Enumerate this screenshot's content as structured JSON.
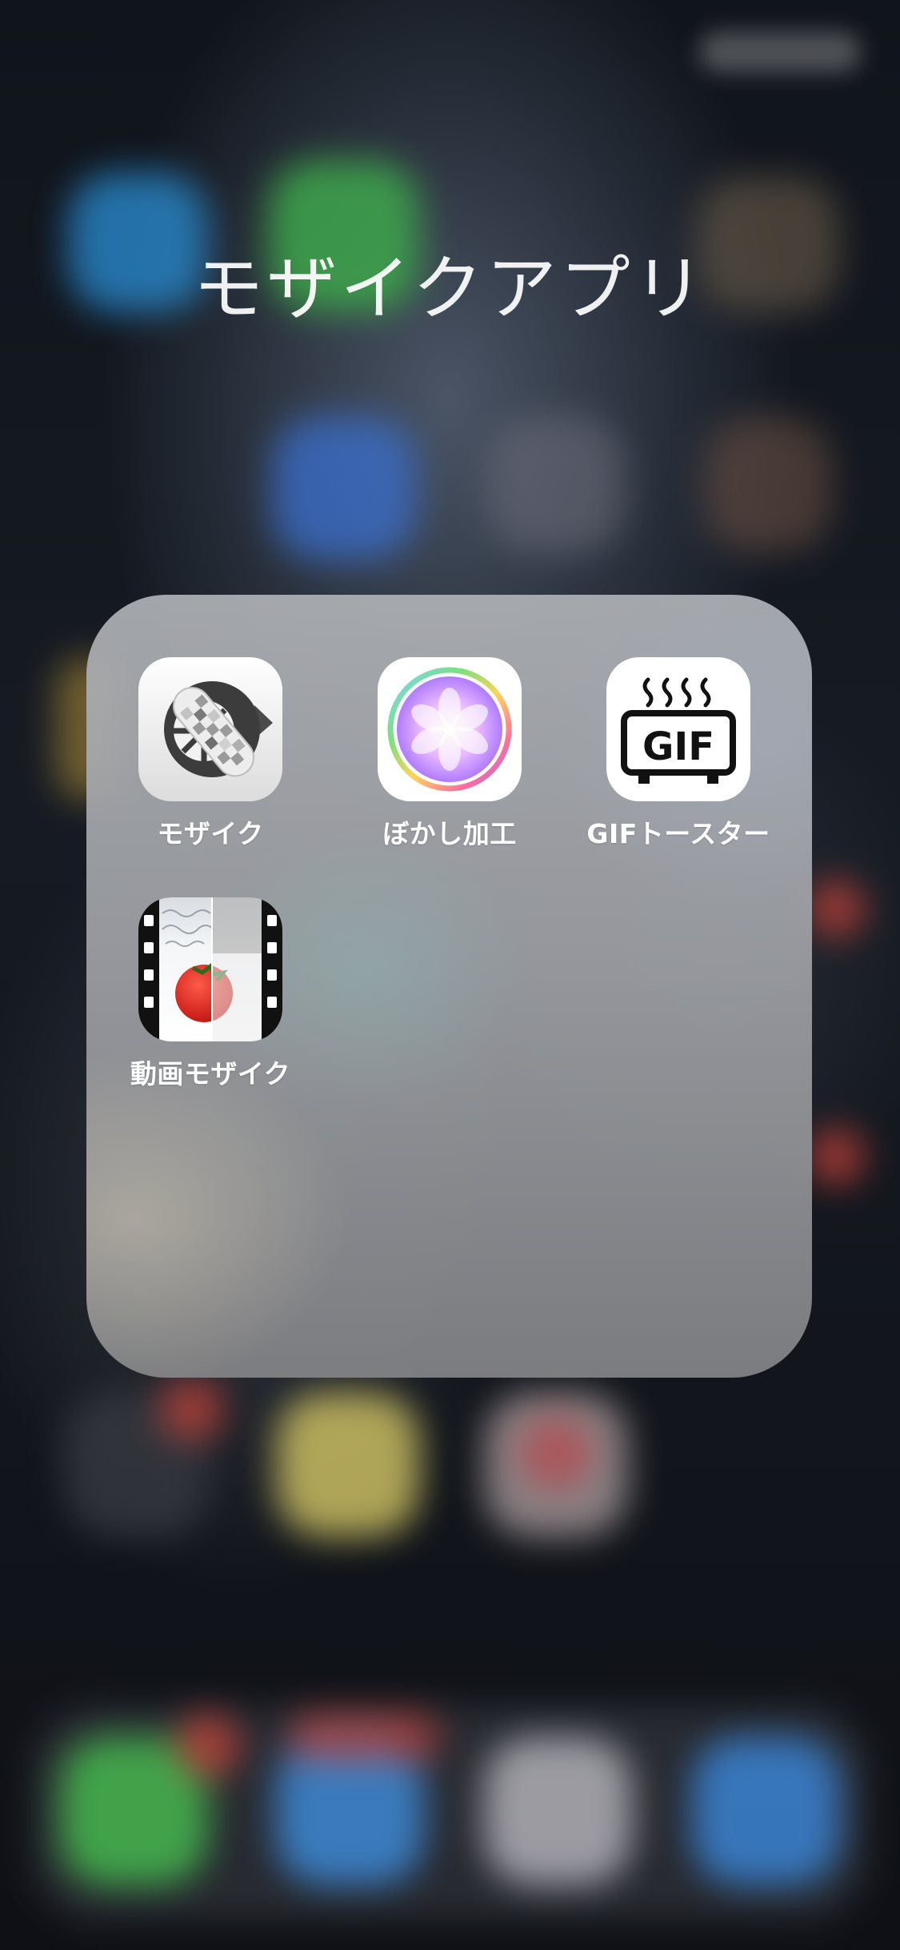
{
  "folder": {
    "title": "モザイクアプリ",
    "apps": [
      {
        "label": "モザイク",
        "icon": "mosaic-wheel-icon"
      },
      {
        "label": "ぼかし加工",
        "icon": "blur-flower-icon"
      },
      {
        "label": "GIFトースター",
        "icon": "gif-toaster-icon",
        "icon_text": "GIF"
      },
      {
        "label": "動画モザイク",
        "icon": "video-mosaic-tomato-icon"
      }
    ]
  },
  "colors": {
    "folder_panel": "#a3a5aa",
    "label_text": "#ffffff",
    "background": "#0b0d12"
  }
}
